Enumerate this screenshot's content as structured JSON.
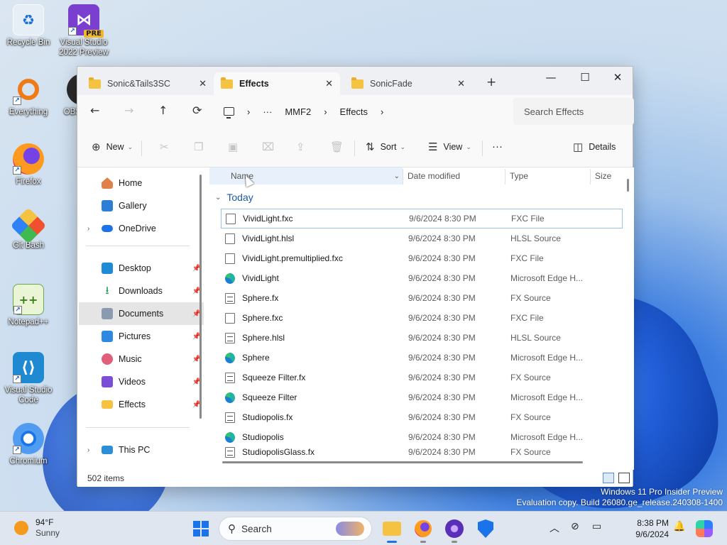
{
  "desktop": {
    "icons": [
      {
        "label": "Recycle Bin",
        "icon": "recycle-bin-icon"
      },
      {
        "label": "Visual Studio 2022 Preview",
        "icon": "visual-studio-icon",
        "badge": "PRE"
      },
      {
        "label": "Everything",
        "icon": "everything-search-icon"
      },
      {
        "label": "OBS",
        "icon": "obs-icon"
      },
      {
        "label": "Firefox",
        "icon": "firefox-icon"
      },
      {
        "label": "Git Bash",
        "icon": "git-bash-icon"
      },
      {
        "label": "Notepad++",
        "icon": "notepad-plus-plus-icon"
      },
      {
        "label": "Visual Studio Code",
        "icon": "vscode-icon"
      },
      {
        "label": "Chromium",
        "icon": "chromium-icon"
      }
    ]
  },
  "explorer": {
    "tabs": [
      {
        "label": "Sonic&Tails3SC",
        "active": false
      },
      {
        "label": "Effects",
        "active": true
      },
      {
        "label": "SonicFade",
        "active": false
      }
    ],
    "window_controls": {
      "minimize": "—",
      "maximize": "☐",
      "close": "✕"
    },
    "breadcrumb": [
      "MMF2",
      "Effects"
    ],
    "breadcrumb_more": "···",
    "search_placeholder": "Search Effects",
    "command_bar": {
      "new_label": "New",
      "sort_label": "Sort",
      "view_label": "View",
      "more_label": "···",
      "details_label": "Details"
    },
    "nav_pane": {
      "items": [
        {
          "label": "Home",
          "icon": "home-icon",
          "color": "#e0814a"
        },
        {
          "label": "Gallery",
          "icon": "gallery-icon",
          "color": "#2d7fd6"
        },
        {
          "label": "OneDrive",
          "icon": "onedrive-icon",
          "color": "#1a73e8"
        },
        {
          "label": "Desktop",
          "icon": "desktop-icon",
          "color": "#1f8bd6"
        },
        {
          "label": "Downloads",
          "icon": "downloads-icon",
          "color": "#1d9b5b"
        },
        {
          "label": "Documents",
          "icon": "documents-icon",
          "color": "#8a9ab0"
        },
        {
          "label": "Pictures",
          "icon": "pictures-icon",
          "color": "#2d8ae0"
        },
        {
          "label": "Music",
          "icon": "music-icon",
          "color": "#e0607a"
        },
        {
          "label": "Videos",
          "icon": "videos-icon",
          "color": "#7a4fd6"
        },
        {
          "label": "Effects",
          "icon": "folder-icon",
          "color": "#f5c242"
        },
        {
          "label": "This PC",
          "icon": "this-pc-icon",
          "color": "#2a8fd6"
        }
      ],
      "selected": "Documents"
    },
    "columns": {
      "name": "Name",
      "date": "Date modified",
      "type": "Type",
      "size": "Size"
    },
    "group_label": "Today",
    "files": [
      {
        "name": "VividLight.fxc",
        "date": "9/6/2024 8:30 PM",
        "type": "FXC File",
        "icon": "blank"
      },
      {
        "name": "VividLight.hlsl",
        "date": "9/6/2024 8:30 PM",
        "type": "HLSL Source",
        "icon": "blank"
      },
      {
        "name": "VividLight.premultiplied.fxc",
        "date": "9/6/2024 8:30 PM",
        "type": "FXC File",
        "icon": "blank"
      },
      {
        "name": "VividLight",
        "date": "9/6/2024 8:30 PM",
        "type": "Microsoft Edge H...",
        "icon": "edge"
      },
      {
        "name": "Sphere.fx",
        "date": "9/6/2024 8:30 PM",
        "type": "FX Source",
        "icon": "code"
      },
      {
        "name": "Sphere.fxc",
        "date": "9/6/2024 8:30 PM",
        "type": "FXC File",
        "icon": "blank"
      },
      {
        "name": "Sphere.hlsl",
        "date": "9/6/2024 8:30 PM",
        "type": "HLSL Source",
        "icon": "code"
      },
      {
        "name": "Sphere",
        "date": "9/6/2024 8:30 PM",
        "type": "Microsoft Edge H...",
        "icon": "edge"
      },
      {
        "name": "Squeeze Filter.fx",
        "date": "9/6/2024 8:30 PM",
        "type": "FX Source",
        "icon": "code"
      },
      {
        "name": "Squeeze Filter",
        "date": "9/6/2024 8:30 PM",
        "type": "Microsoft Edge H...",
        "icon": "edge"
      },
      {
        "name": "Studiopolis.fx",
        "date": "9/6/2024 8:30 PM",
        "type": "FX Source",
        "icon": "code"
      },
      {
        "name": "Studiopolis",
        "date": "9/6/2024 8:30 PM",
        "type": "Microsoft Edge H...",
        "icon": "edge"
      },
      {
        "name": "StudiopolisGlass.fx",
        "date": "9/6/2024 8:30 PM",
        "type": "FX Source",
        "icon": "code"
      }
    ],
    "status_text": "502 items"
  },
  "watermark": {
    "line1": "Windows 11 Pro Insider Preview",
    "line2": "Evaluation copy. Build 26080.ge_release.240308-1400"
  },
  "taskbar": {
    "weather_temp": "94°F",
    "weather_cond": "Sunny",
    "search_label": "Search",
    "time": "8:38 PM",
    "date": "9/6/2024"
  }
}
